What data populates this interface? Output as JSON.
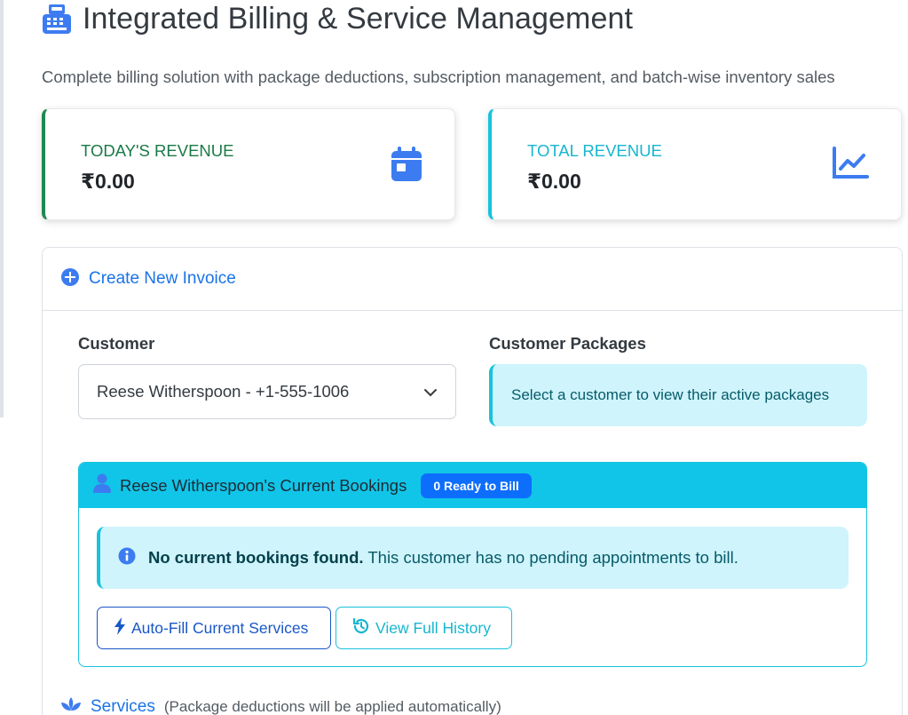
{
  "header": {
    "title": "Integrated Billing & Service Management",
    "subtitle": "Complete billing solution with package deductions, subscription management, and batch-wise inventory sales",
    "title_icon": "cash-register-icon"
  },
  "stats": [
    {
      "label": "TODAY'S REVENUE",
      "value": "₹0.00",
      "icon": "calendar-icon",
      "accent": "#1e8a52"
    },
    {
      "label": "TOTAL REVENUE",
      "value": "₹0.00",
      "icon": "chart-line-icon",
      "accent": "#17c3dc"
    }
  ],
  "invoice": {
    "header": "Create New Invoice",
    "customer_label": "Customer",
    "customer_value": "Reese Witherspoon - +1-555-1006",
    "packages_label": "Customer Packages",
    "packages_message": "Select a customer to view their active packages",
    "bookings": {
      "title": "Reese Witherspoon's Current Bookings",
      "badge": "0 Ready to Bill",
      "alert_strong": "No current bookings found.",
      "alert_text": "This customer has no pending appointments to bill.",
      "autofill_button": "Auto-Fill Current Services",
      "history_button": "View Full History"
    },
    "services_title": "Services",
    "services_note": "(Package deductions will be applied automatically)"
  },
  "colors": {
    "primary": "#1a73e8",
    "info": "#17c3dc",
    "success": "#1e8a52",
    "badge": "#0d6efd"
  }
}
